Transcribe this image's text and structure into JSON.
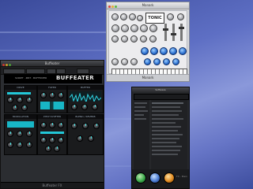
{
  "windows": {
    "synth": {
      "title": "Monark",
      "logo": "TONIC",
      "status": "Monark"
    },
    "plugin": {
      "title": "Buffeater",
      "brand": "BUFFEATER",
      "brand_sub": "SCRIPT · 4BIT · BUFFEATER",
      "status": "Buffeater FX",
      "panels": {
        "tl": "DRIVE",
        "ml": "FILTER",
        "mr": "BUFFER",
        "bl": "MODULATION",
        "bm": "PITCH SHIFTER",
        "bmid": "BLEND / REVERB"
      }
    },
    "browser": {
      "title": "Software",
      "footer_label": "FX - Main"
    }
  },
  "colors": {
    "desktop": "#5e6fc4",
    "accent_cyan": "#22c8d8",
    "synth_knob_blue": "#2a6fd0",
    "orange_knob": "#e08a20",
    "green_knob": "#3aa84a"
  }
}
